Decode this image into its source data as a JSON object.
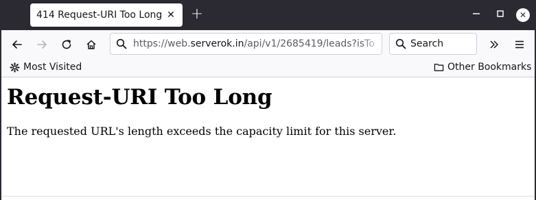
{
  "tab": {
    "title": "414 Request-URI Too Long",
    "close_icon": "close-icon",
    "new_tab_icon": "plus-icon"
  },
  "window": {
    "minimize_icon": "minimize-icon",
    "maximize_icon": "maximize-icon",
    "close_icon": "close-icon"
  },
  "nav": {
    "back_icon": "arrow-left-icon",
    "forward_icon": "arrow-right-icon",
    "reload_icon": "reload-icon",
    "home_icon": "home-icon",
    "url_prefix": "https://web.",
    "url_host": "serverok.in",
    "url_path": "/api/v1/2685419/leads?isTo",
    "search_placeholder": "Search",
    "overflow_icon": "chevron-double-right-icon",
    "menu_icon": "hamburger-menu-icon"
  },
  "bookmarks": {
    "most_visited": "Most Visited",
    "other_bookmarks": "Other Bookmarks"
  },
  "page": {
    "heading": "Request-URI Too Long",
    "message": "The requested URL's length exceeds the capacity limit for this server."
  },
  "colors": {
    "titlebar": "#2b2a33",
    "toolbar": "#f9f9fb",
    "content_bg": "#ffffff"
  }
}
